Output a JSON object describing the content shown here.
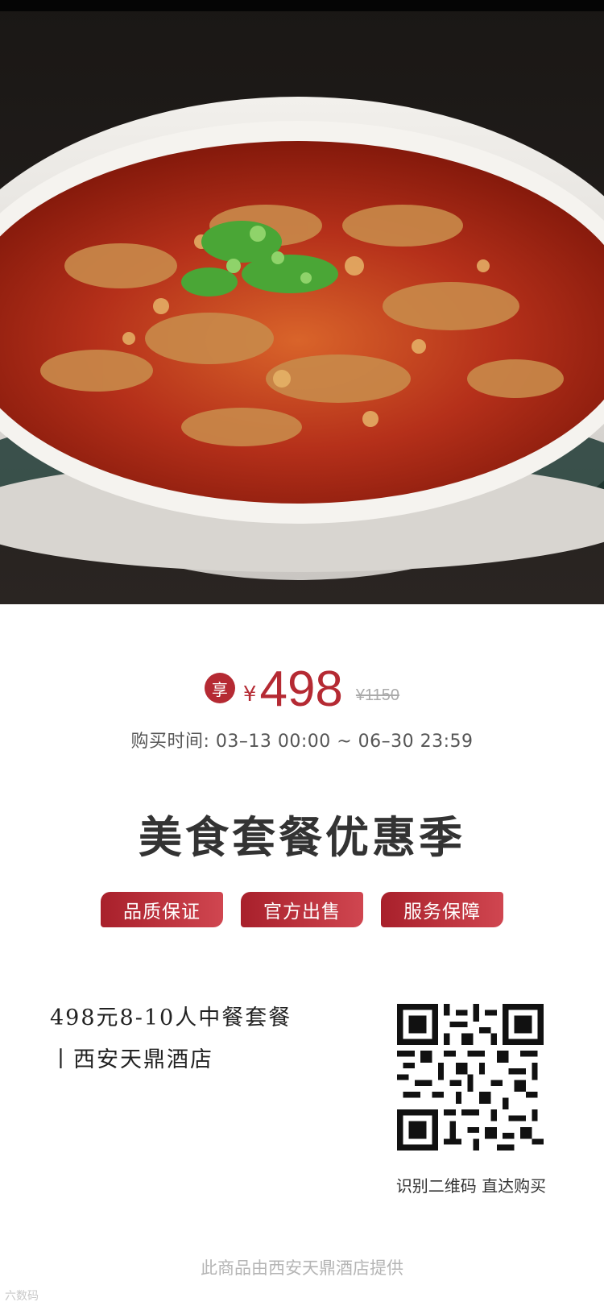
{
  "hero": {
    "image_desc": "spicy-boiled-pork-dish-photo"
  },
  "price": {
    "badge": "享",
    "currency": "¥",
    "current": "498",
    "original": "¥1150"
  },
  "purchase_time": "购买时间:  03–13 00:00 ~ 06–30 23:59",
  "headline": "美食套餐优惠季",
  "tags": [
    "品质保证",
    "官方出售",
    "服务保障"
  ],
  "product": {
    "line1": "498元8-10人中餐套餐",
    "line2": "丨西安天鼎酒店"
  },
  "qr_caption": "识别二维码 直达购买",
  "footer": "此商品由西安天鼎酒店提供",
  "watermark": "六数码",
  "colors": {
    "accent": "#b52a33",
    "muted": "#aaaaaa"
  }
}
